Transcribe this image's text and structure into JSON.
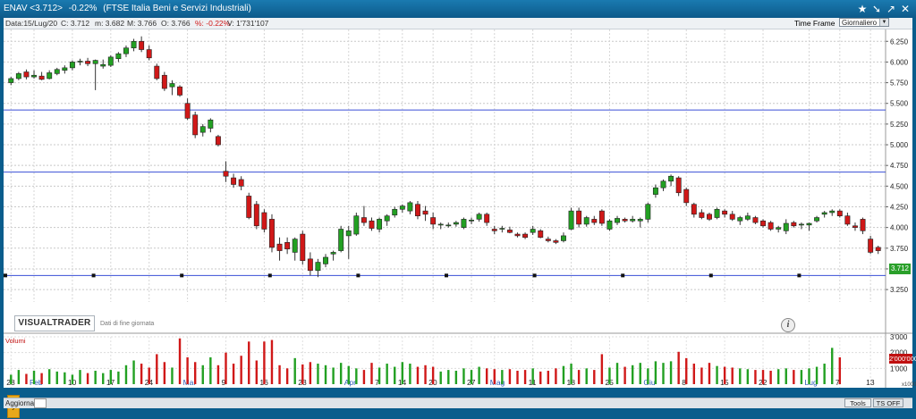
{
  "title_bar": {
    "symbol": "ENAV <3.712>",
    "change": "-0.22%",
    "index": "(FTSE Italia Beni e Servizi Industriali)"
  },
  "info_bar": {
    "date": "Data:15/Lug/20",
    "close": "C: 3.712",
    "min": "m: 3.682",
    "max": "M: 3.766",
    "open": "O: 3.766",
    "pct": "%: -0.22%",
    "vol": "V: 1'731'107"
  },
  "time_frame": {
    "label": "Time Frame",
    "value": "Giornaliero"
  },
  "branding": {
    "logo": "VISUALTRADER",
    "note": "Dati di fine giornata"
  },
  "price_label": "3.712",
  "volume_label": "Volumi",
  "volume_marker": "2'000'000",
  "volume_unit": "x1000",
  "bottom": {
    "refresh": "Aggiorna",
    "tools": "Tools",
    "ts": "TS OFF"
  },
  "colors": {
    "up": "#22a022",
    "down": "#d01818",
    "line": "#3a4fd6"
  },
  "chart_data": {
    "type": "candlestick",
    "y_ticks": [
      3.25,
      3.5,
      3.75,
      4.0,
      4.25,
      4.5,
      4.75,
      5.0,
      5.25,
      5.5,
      5.75,
      6.0,
      6.25
    ],
    "y_tick_labels": [
      "3.250",
      "3.500",
      "3.750",
      "4.000",
      "4.250",
      "4.500",
      "4.750",
      "5.000",
      "5.250",
      "5.500",
      "5.750",
      "6.000",
      "6.250"
    ],
    "ylim": [
      3.1,
      6.35
    ],
    "horizontal_lines": [
      5.42,
      4.67,
      3.42
    ],
    "x_labels": [
      {
        "text": "28",
        "i": 0,
        "month": false
      },
      {
        "text": "Feb",
        "i": 3,
        "month": true
      },
      {
        "text": "10",
        "i": 8,
        "month": false
      },
      {
        "text": "17",
        "i": 13,
        "month": false
      },
      {
        "text": "24",
        "i": 18,
        "month": false
      },
      {
        "text": "Mar",
        "i": 23,
        "month": true
      },
      {
        "text": "9",
        "i": 28,
        "month": false
      },
      {
        "text": "16",
        "i": 33,
        "month": false
      },
      {
        "text": "23",
        "i": 38,
        "month": false
      },
      {
        "text": "Apr",
        "i": 44,
        "month": true
      },
      {
        "text": "7",
        "i": 48,
        "month": false
      },
      {
        "text": "14",
        "i": 51,
        "month": false
      },
      {
        "text": "20",
        "i": 55,
        "month": false
      },
      {
        "text": "27",
        "i": 60,
        "month": false
      },
      {
        "text": "Mag",
        "i": 63,
        "month": true
      },
      {
        "text": "11",
        "i": 68,
        "month": false
      },
      {
        "text": "18",
        "i": 73,
        "month": false
      },
      {
        "text": "25",
        "i": 78,
        "month": false
      },
      {
        "text": "Giu",
        "i": 83,
        "month": true
      },
      {
        "text": "8",
        "i": 88,
        "month": false
      },
      {
        "text": "15",
        "i": 93,
        "month": false
      },
      {
        "text": "22",
        "i": 98,
        "month": false
      },
      {
        "text": "Lug",
        "i": 104,
        "month": true
      },
      {
        "text": "7",
        "i": 108,
        "month": false
      },
      {
        "text": "13",
        "i": 112,
        "month": false
      }
    ],
    "candles": [
      [
        5.75,
        5.82,
        5.72,
        5.8
      ],
      [
        5.8,
        5.88,
        5.78,
        5.86
      ],
      [
        5.88,
        5.91,
        5.79,
        5.82
      ],
      [
        5.82,
        5.9,
        5.8,
        5.84
      ],
      [
        5.83,
        5.88,
        5.78,
        5.79
      ],
      [
        5.8,
        5.9,
        5.79,
        5.87
      ],
      [
        5.86,
        5.93,
        5.84,
        5.91
      ],
      [
        5.9,
        5.96,
        5.86,
        5.93
      ],
      [
        5.93,
        6.02,
        5.9,
        6.0
      ],
      [
        6.0,
        6.04,
        5.96,
        6.01
      ],
      [
        6.01,
        6.05,
        5.95,
        5.98
      ],
      [
        5.98,
        6.03,
        5.66,
        6.02
      ],
      [
        5.95,
        6.03,
        5.92,
        5.97
      ],
      [
        5.96,
        6.08,
        5.94,
        6.06
      ],
      [
        6.04,
        6.12,
        6.0,
        6.1
      ],
      [
        6.1,
        6.2,
        6.06,
        6.17
      ],
      [
        6.17,
        6.28,
        6.13,
        6.25
      ],
      [
        6.25,
        6.31,
        6.12,
        6.15
      ],
      [
        6.15,
        6.2,
        6.02,
        6.05
      ],
      [
        5.95,
        5.98,
        5.78,
        5.8
      ],
      [
        5.84,
        5.88,
        5.65,
        5.68
      ],
      [
        5.7,
        5.78,
        5.6,
        5.74
      ],
      [
        5.7,
        5.72,
        5.58,
        5.6
      ],
      [
        5.5,
        5.56,
        5.3,
        5.32
      ],
      [
        5.36,
        5.4,
        5.08,
        5.12
      ],
      [
        5.15,
        5.25,
        5.1,
        5.22
      ],
      [
        5.2,
        5.32,
        5.15,
        5.3
      ],
      [
        5.1,
        5.12,
        4.98,
        5.0
      ],
      [
        4.68,
        4.8,
        4.55,
        4.62
      ],
      [
        4.6,
        4.65,
        4.48,
        4.52
      ],
      [
        4.58,
        4.62,
        4.45,
        4.5
      ],
      [
        4.38,
        4.42,
        4.1,
        4.12
      ],
      [
        4.28,
        4.32,
        3.98,
        4.02
      ],
      [
        4.18,
        4.22,
        3.94,
        3.98
      ],
      [
        4.1,
        4.16,
        3.7,
        3.76
      ],
      [
        3.8,
        3.88,
        3.6,
        3.72
      ],
      [
        3.82,
        3.88,
        3.68,
        3.74
      ],
      [
        3.7,
        3.88,
        3.6,
        3.86
      ],
      [
        3.92,
        3.96,
        3.55,
        3.6
      ],
      [
        3.62,
        3.7,
        3.42,
        3.48
      ],
      [
        3.48,
        3.62,
        3.4,
        3.58
      ],
      [
        3.56,
        3.68,
        3.52,
        3.64
      ],
      [
        3.68,
        3.72,
        3.6,
        3.7
      ],
      [
        3.72,
        4.02,
        3.7,
        3.98
      ],
      [
        3.9,
        4.02,
        3.62,
        3.96
      ],
      [
        3.92,
        4.18,
        3.9,
        4.14
      ],
      [
        4.12,
        4.26,
        4.02,
        4.06
      ],
      [
        4.08,
        4.12,
        3.96,
        3.99
      ],
      [
        3.98,
        4.12,
        3.94,
        4.1
      ],
      [
        4.08,
        4.16,
        4.02,
        4.14
      ],
      [
        4.15,
        4.25,
        4.12,
        4.22
      ],
      [
        4.22,
        4.28,
        4.18,
        4.26
      ],
      [
        4.2,
        4.32,
        4.16,
        4.3
      ],
      [
        4.28,
        4.32,
        4.1,
        4.14
      ],
      [
        4.2,
        4.26,
        4.08,
        4.16
      ],
      [
        4.12,
        4.18,
        3.98,
        4.04
      ],
      [
        4.03,
        4.06,
        3.98,
        4.04
      ],
      [
        4.02,
        4.06,
        4.0,
        4.03
      ],
      [
        4.04,
        4.08,
        4.01,
        4.06
      ],
      [
        4.0,
        4.12,
        3.98,
        4.1
      ],
      [
        4.08,
        4.12,
        4.04,
        4.09
      ],
      [
        4.1,
        4.18,
        4.07,
        4.16
      ],
      [
        4.16,
        4.18,
        4.02,
        4.06
      ],
      [
        3.98,
        4.02,
        3.92,
        3.96
      ],
      [
        3.98,
        4.02,
        3.94,
        3.99
      ],
      [
        3.97,
        4.01,
        3.93,
        3.94
      ],
      [
        3.92,
        3.94,
        3.88,
        3.9
      ],
      [
        3.92,
        3.94,
        3.86,
        3.88
      ],
      [
        3.94,
        4.02,
        3.91,
        3.98
      ],
      [
        3.96,
        3.98,
        3.87,
        3.88
      ],
      [
        3.86,
        3.89,
        3.82,
        3.84
      ],
      [
        3.84,
        3.86,
        3.8,
        3.82
      ],
      [
        3.84,
        3.94,
        3.82,
        3.9
      ],
      [
        3.98,
        4.24,
        3.97,
        4.2
      ],
      [
        4.2,
        4.24,
        4.0,
        4.04
      ],
      [
        4.04,
        4.14,
        4.01,
        4.12
      ],
      [
        4.1,
        4.14,
        4.03,
        4.06
      ],
      [
        4.2,
        4.22,
        4.02,
        4.05
      ],
      [
        3.98,
        4.1,
        3.96,
        4.08
      ],
      [
        4.06,
        4.14,
        4.03,
        4.11
      ],
      [
        4.1,
        4.12,
        4.06,
        4.08
      ],
      [
        4.08,
        4.14,
        4.06,
        4.1
      ],
      [
        4.08,
        4.12,
        4.0,
        4.1
      ],
      [
        4.1,
        4.3,
        4.06,
        4.28
      ],
      [
        4.4,
        4.52,
        4.36,
        4.48
      ],
      [
        4.48,
        4.58,
        4.44,
        4.56
      ],
      [
        4.56,
        4.64,
        4.5,
        4.62
      ],
      [
        4.6,
        4.62,
        4.38,
        4.42
      ],
      [
        4.46,
        4.48,
        4.26,
        4.3
      ],
      [
        4.28,
        4.3,
        4.12,
        4.16
      ],
      [
        4.18,
        4.22,
        4.1,
        4.12
      ],
      [
        4.16,
        4.18,
        4.08,
        4.1
      ],
      [
        4.12,
        4.24,
        4.1,
        4.22
      ],
      [
        4.2,
        4.22,
        4.12,
        4.16
      ],
      [
        4.16,
        4.2,
        4.08,
        4.1
      ],
      [
        4.08,
        4.14,
        4.03,
        4.12
      ],
      [
        4.1,
        4.18,
        4.08,
        4.14
      ],
      [
        4.12,
        4.14,
        4.04,
        4.06
      ],
      [
        4.08,
        4.1,
        4.0,
        4.02
      ],
      [
        4.06,
        4.08,
        3.96,
        3.98
      ],
      [
        3.98,
        4.02,
        3.94,
        4.0
      ],
      [
        3.96,
        4.1,
        3.92,
        4.05
      ],
      [
        4.06,
        4.08,
        4.0,
        4.02
      ],
      [
        4.04,
        4.06,
        3.98,
        4.04
      ],
      [
        4.03,
        4.06,
        3.96,
        4.05
      ],
      [
        4.08,
        4.14,
        4.06,
        4.12
      ],
      [
        4.16,
        4.2,
        4.12,
        4.18
      ],
      [
        4.18,
        4.22,
        4.14,
        4.2
      ],
      [
        4.2,
        4.22,
        4.12,
        4.14
      ],
      [
        4.14,
        4.18,
        4.02,
        4.04
      ],
      [
        4.02,
        4.06,
        3.96,
        4.0
      ],
      [
        4.1,
        4.12,
        3.92,
        3.96
      ],
      [
        3.86,
        3.9,
        3.68,
        3.7
      ],
      [
        3.76,
        3.78,
        3.68,
        3.72
      ]
    ],
    "volumes_thousands": [
      600,
      900,
      650,
      850,
      700,
      950,
      800,
      750,
      600,
      900,
      700,
      850,
      700,
      900,
      800,
      1200,
      1500,
      1300,
      1050,
      1900,
      1400,
      1050,
      2900,
      1700,
      1400,
      1200,
      1700,
      1200,
      2000,
      1300,
      1800,
      2700,
      1500,
      2700,
      2800,
      1200,
      1000,
      1650,
      1250,
      1400,
      1300,
      1200,
      1050,
      1350,
      1150,
      1000,
      900,
      1350,
      1050,
      1300,
      1100,
      1400,
      1300,
      1100,
      1200,
      1100,
      800,
      900,
      850,
      1000,
      900,
      1100,
      1000,
      950,
      900,
      950,
      850,
      900,
      1000,
      800,
      850,
      1000,
      1150,
      1300,
      900,
      1000,
      900,
      1900,
      1050,
      1350,
      1100,
      1200,
      1350,
      1000,
      1450,
      1350,
      1450,
      2050,
      1650,
      1300,
      1050,
      1350,
      1150,
      1100,
      1050,
      1000,
      950,
      900,
      900,
      850,
      950,
      1000,
      900,
      900,
      1000,
      1100,
      1300,
      2300,
      1700
    ]
  }
}
